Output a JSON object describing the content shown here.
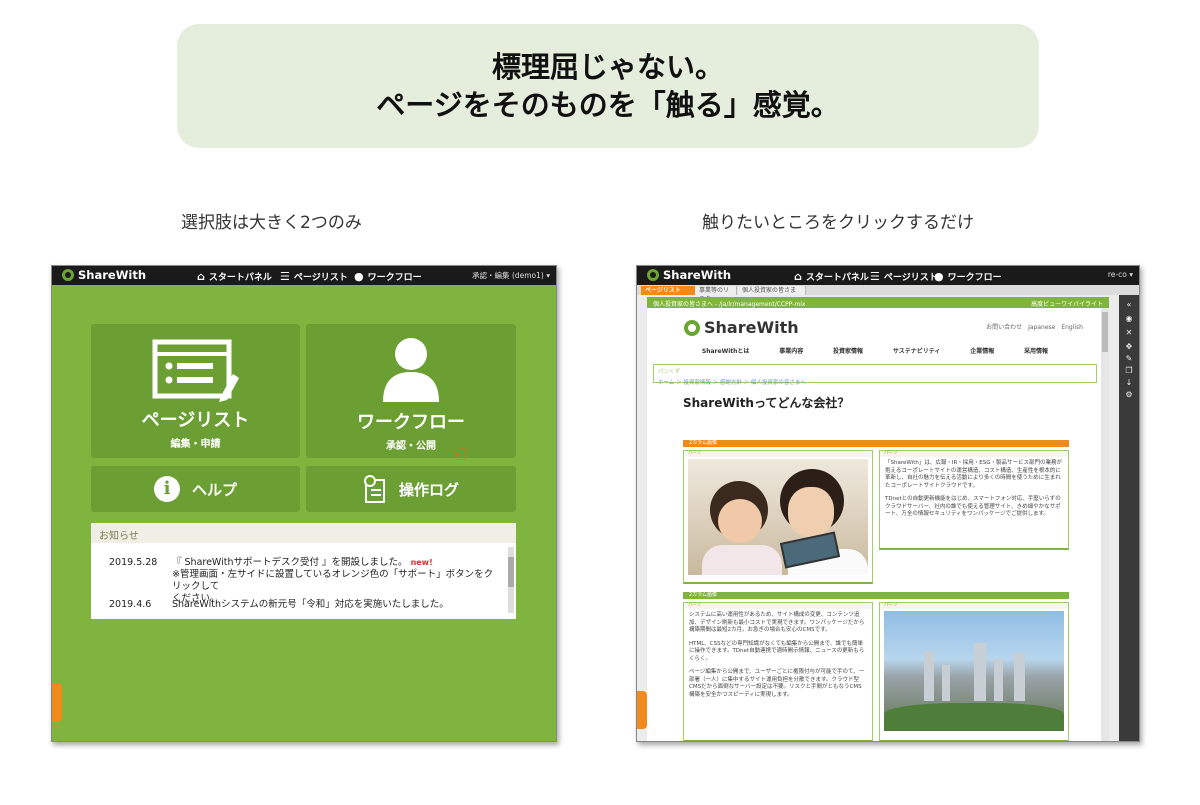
{
  "headline": {
    "line1": "標理屈じゃない。",
    "line2": "ページをそのものを「触る」感覚。"
  },
  "captions": {
    "left": "選択肢は大きく2つのみ",
    "right": "触りたいところをクリックするだけ"
  },
  "app": {
    "logo": "ShareWith",
    "nav": [
      "スタートパネル",
      "ページリスト",
      "ワークフロー"
    ],
    "user_left": "承認・編集 (demo1) ▾",
    "user_right": "re-co ▾"
  },
  "left_screen": {
    "tiles": [
      {
        "title": "ページリスト",
        "sub": "編集・申請"
      },
      {
        "title": "ワークフロー",
        "sub": "承認・公開"
      }
    ],
    "help": "ヘルプ",
    "log": "操作ログ",
    "news": {
      "heading": "お知らせ",
      "items": [
        {
          "date": "2019.5.28",
          "text": "『 ShareWithサポートデスク受付 』を開設しました。",
          "badge": "new!",
          "text2": "※管理画面・左サイドに設置しているオレンジ色の「サポート」ボタンをクリックして",
          "text3": "ください。"
        },
        {
          "date": "2019.4.6",
          "text": "ShareWithシステムの新元号「令和」対応を実施いたしました。"
        }
      ]
    }
  },
  "right_screen": {
    "tabs": [
      "ページリスト",
      "事業等のリスク",
      "個人投資家の皆さまへ"
    ],
    "url": "個人投資家の皆さまへ - /ja/ir/management/CCPP-mix",
    "url_right": "高度ビューワイパイライト",
    "site_logo": "ShareWith",
    "site_top_links": "お問い合わせ　Japanese　English",
    "site_nav": [
      "ShareWithとは",
      "事業内容",
      "投資家情報",
      "サステナビリティ",
      "企業情報",
      "采用情報"
    ],
    "breadcrumb_label": "パンくず",
    "breadcrumb": "ホーム ＞ 投資家情報 ＞ 感謝方針 ＞ 個人投資家の皆さまへ",
    "page_title": "ShareWithってどんな会社？",
    "block_label": "2カラム画像",
    "col_label": "パーツ",
    "text_a": "「ShareWith」は、広報・IR・採用・ESG・製品サービス部門の業務が抱えるコーポレートサイトの運営構造、コスト構造、生産性を根本的に革新し、自社の魅力を伝える活動により多くの時間を使うために生まれたコーポレートサイトクラウドです。",
    "text_b": "TDnetとの自動更新機能をはじめ、スマートフォン対応、手堅いらずのクラウドサーバー、社内の誰でも使える管理サイト、きめ細やかなサポート、万全の情報セキュリティをワンパッケージでご提供します。",
    "text_c": "システムに高い運用性があるため、サイト構成の変更、コンテンツ追加、デザイン刷新も最小コストで実現できます。ワンパッケージだから構築期間は最短2カ月。お急ぎの場合も安心のCMSです。",
    "text_d": "HTML、CSSなどの専門知識がなくても編集から公開まで、誰でも簡単に操作できます。TDnet自動連携で適時開示情報、ニュースの更新もらくらく。",
    "text_e": "ページ編集から公開まで、ユーザーごとに権限付与が可能で手のて、一部署（一人）に集中するサイト運用負担を分散できます。クラウド型CMSだから面倒なサーバー設定は不要。リスクと手間がともなうCMS構築を安全かつスピーディに実現します。"
  },
  "colors": {
    "banner_bg": "#e5eedc",
    "app_green": "#7fb53f",
    "tile_green": "#6c9f33",
    "accent_orange": "#f08a1c",
    "topbar": "#1a1a1a"
  }
}
